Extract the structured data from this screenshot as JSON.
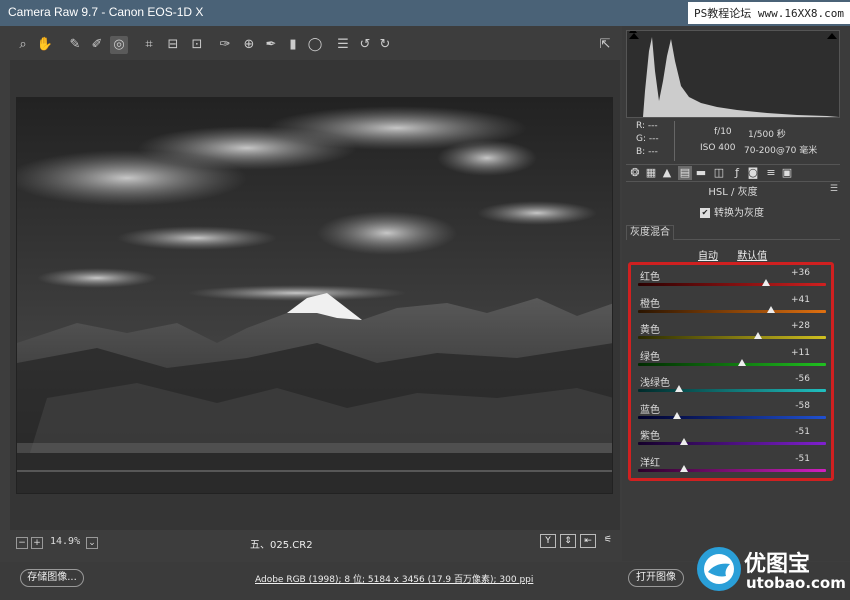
{
  "window": {
    "title": "Camera Raw 9.7  -  Canon EOS-1D X"
  },
  "watermark": {
    "text": "PS教程论坛 www.16XX8.com"
  },
  "toolbar": {
    "tools": [
      "zoom-icon",
      "hand-icon",
      "white-balance-icon",
      "color-sampler-icon",
      "targeted-adjustment-icon",
      "crop-icon",
      "straighten-icon",
      "transform-icon",
      "spot-removal-icon",
      "red-eye-icon",
      "adjustment-brush-icon",
      "graduated-filter-icon",
      "radial-filter-icon",
      "preferences-icon",
      "rotate-ccw-icon",
      "rotate-cw-icon"
    ],
    "active_tool": "targeted-adjustment-icon",
    "fullscreen_icon": "fullscreen-icon"
  },
  "preview": {
    "zoom": "14.9%",
    "filename": "五、025.CR2",
    "view_buttons": [
      "Y",
      "⇕",
      "⇤",
      "⚟"
    ]
  },
  "info": {
    "r_label": "R:",
    "g_label": "G:",
    "b_label": "B:",
    "r_value": "---",
    "g_value": "---",
    "b_value": "---",
    "aperture": "f/10",
    "shutter": "1/500 秒",
    "iso": "ISO 400",
    "lens": "70-200@70 毫米"
  },
  "panel": {
    "tabs": [
      "basic-icon",
      "tone-curve-icon",
      "detail-icon",
      "hsl-icon",
      "split-toning-icon",
      "lens-icon",
      "fx-icon",
      "camera-calibration-icon",
      "presets-icon",
      "snapshots-icon"
    ],
    "active_tab": "hsl-icon",
    "section_title": "HSL / 灰度",
    "convert_label": "转换为灰度",
    "convert_checked": true,
    "mix_tab": "灰度混合",
    "auto_link": "自动",
    "default_link": "默认值"
  },
  "sliders": [
    {
      "label": "红色",
      "value": "+36",
      "pos": 0.68,
      "gradient": "linear-gradient(to right,#2a0000,#d02020)"
    },
    {
      "label": "橙色",
      "value": "+41",
      "pos": 0.705,
      "gradient": "linear-gradient(to right,#2a1400,#e07010)"
    },
    {
      "label": "黄色",
      "value": "+28",
      "pos": 0.64,
      "gradient": "linear-gradient(to right,#2a2a00,#d0c020)"
    },
    {
      "label": "绿色",
      "value": "+11",
      "pos": 0.555,
      "gradient": "linear-gradient(to right,#002a00,#20c020)"
    },
    {
      "label": "浅绿色",
      "value": "-56",
      "pos": 0.22,
      "gradient": "linear-gradient(to right,#002a2a,#20c0c0)"
    },
    {
      "label": "蓝色",
      "value": "-58",
      "pos": 0.21,
      "gradient": "linear-gradient(to right,#00002a,#2050d0)"
    },
    {
      "label": "紫色",
      "value": "-51",
      "pos": 0.245,
      "gradient": "linear-gradient(to right,#14002a,#8020d0)"
    },
    {
      "label": "洋红",
      "value": "-51",
      "pos": 0.245,
      "gradient": "linear-gradient(to right,#2a002a,#d020c0)"
    }
  ],
  "footer": {
    "save_label": "存储图像...",
    "workflow": "Adobe RGB (1998); 8 位; 5184 x 3456 (17.9 百万像素); 300 ppi",
    "open_label": "打开图像"
  },
  "logo": {
    "text": "优图宝",
    "sub": "utobao.com"
  }
}
